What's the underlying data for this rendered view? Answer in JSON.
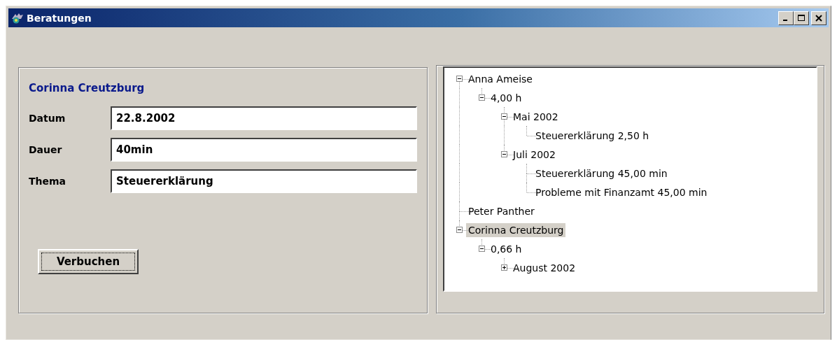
{
  "window": {
    "title": "Beratungen"
  },
  "form": {
    "heading": "Corinna Creutzburg",
    "fields": [
      {
        "label": "Datum",
        "value": "22.8.2002"
      },
      {
        "label": "Dauer",
        "value": "40min"
      },
      {
        "label": "Thema",
        "value": "Steuererklärung"
      }
    ],
    "button": "Verbuchen"
  },
  "tree": [
    {
      "label": "Anna Ameise",
      "selected": false,
      "expanded": true,
      "children": [
        {
          "label": "4,00 h",
          "selected": false,
          "expanded": true,
          "children": [
            {
              "label": "Mai 2002",
              "selected": false,
              "expanded": true,
              "children": [
                {
                  "label": "Steuererklärung 2,50 h",
                  "selected": false
                }
              ]
            },
            {
              "label": "Juli 2002",
              "selected": false,
              "expanded": true,
              "children": [
                {
                  "label": "Steuererklärung 45,00 min",
                  "selected": false
                },
                {
                  "label": "Probleme mit Finanzamt 45,00 min",
                  "selected": false
                }
              ]
            }
          ]
        }
      ]
    },
    {
      "label": "Peter Panther",
      "selected": false
    },
    {
      "label": "Corinna Creutzburg",
      "selected": true,
      "expanded": true,
      "children": [
        {
          "label": "0,66 h",
          "selected": false,
          "expanded": true,
          "children": [
            {
              "label": "August 2002",
              "selected": false,
              "expanded": false
            }
          ]
        }
      ]
    }
  ]
}
